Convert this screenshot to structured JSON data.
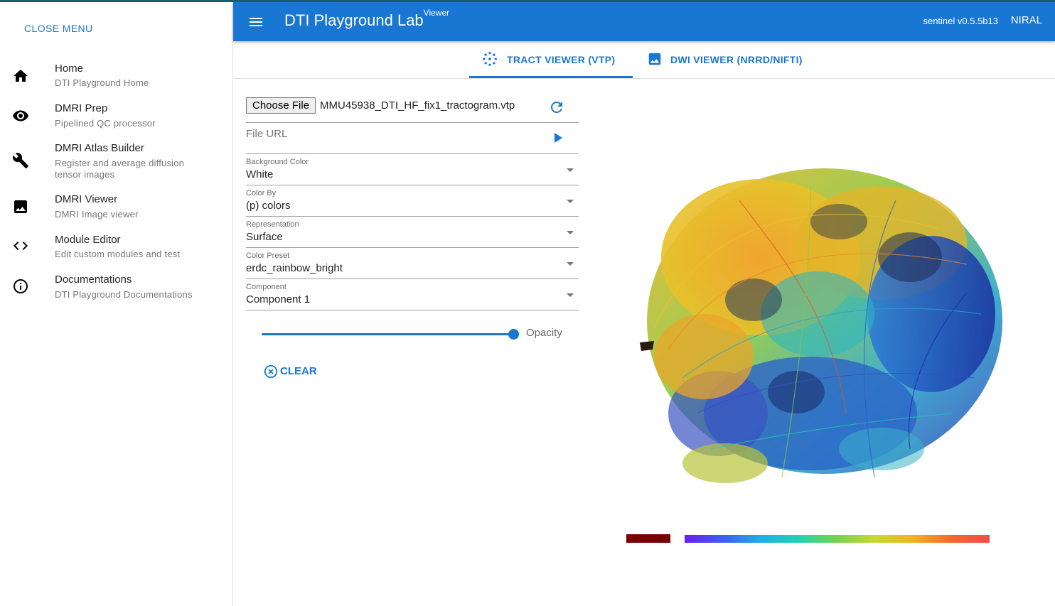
{
  "colors": {
    "primary": "#1976d2",
    "topline": "#1a5f6e",
    "legend_dark": "#7a0000"
  },
  "sidebar": {
    "close_label": "CLOSE MENU",
    "items": [
      {
        "icon": "home-icon",
        "title": "Home",
        "subtitle": "DTI Playground Home"
      },
      {
        "icon": "eye-icon",
        "title": "DMRI Prep",
        "subtitle": "Pipelined QC processor"
      },
      {
        "icon": "wrench-icon",
        "title": "DMRI Atlas Builder",
        "subtitle": "Register and average diffusion tensor images"
      },
      {
        "icon": "image-icon",
        "title": "DMRI Viewer",
        "subtitle": "DMRI Image viewer"
      },
      {
        "icon": "code-icon",
        "title": "Module Editor",
        "subtitle": "Edit custom modules and test"
      },
      {
        "icon": "info-icon",
        "title": "Documentations",
        "subtitle": "DTI Playground Documentations"
      }
    ]
  },
  "appbar": {
    "title": "DTI Playground Lab",
    "title_sup": "Viewer",
    "version": "sentinel v0.5.5b13",
    "org": "NIRAL"
  },
  "tabs": [
    {
      "label": "TRACT VIEWER (VTP)",
      "icon": "tract-icon",
      "active": true
    },
    {
      "label": "DWI VIEWER (NRRD/NIFTI)",
      "icon": "image-icon",
      "active": false
    }
  ],
  "form": {
    "choose_file_label": "Choose File",
    "file_name": "MMU45938_DTI_HF_fix1_tractogram.vtp",
    "url_placeholder": "File URL",
    "selects": [
      {
        "label": "Background Color",
        "value": "White"
      },
      {
        "label": "Color By",
        "value": "(p) colors"
      },
      {
        "label": "Representation",
        "value": "Surface"
      },
      {
        "label": "Color Preset",
        "value": "erdc_rainbow_bright"
      },
      {
        "label": "Component",
        "value": "Component 1"
      }
    ],
    "opacity_label": "Opacity",
    "opacity_value": 1.0,
    "clear_label": "CLEAR"
  }
}
